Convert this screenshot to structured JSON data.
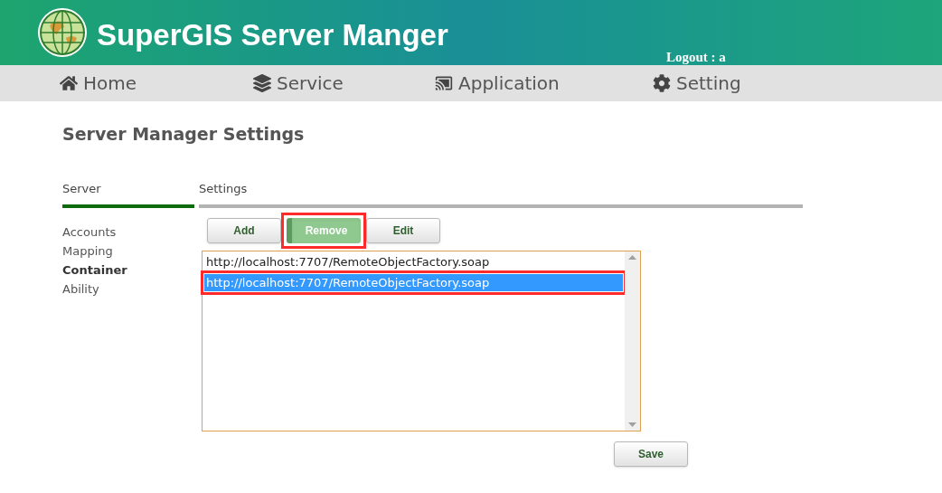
{
  "header": {
    "title": "SuperGIS Server Manger",
    "logout": "Logout : a"
  },
  "nav": [
    {
      "label": "Home"
    },
    {
      "label": "Service"
    },
    {
      "label": "Application"
    },
    {
      "label": "Setting"
    }
  ],
  "page_title": "Server Manager Settings",
  "tabs": [
    {
      "label": "Server",
      "selected": true
    },
    {
      "label": "Settings",
      "selected": false
    }
  ],
  "side_menu": [
    {
      "label": "Accounts",
      "selected": false
    },
    {
      "label": "Mapping",
      "selected": false
    },
    {
      "label": "Container",
      "selected": true
    },
    {
      "label": "Ability",
      "selected": false
    }
  ],
  "buttons": [
    {
      "label": "Add",
      "pressed": false,
      "highlighted": false
    },
    {
      "label": "Remove",
      "pressed": true,
      "highlighted": true
    },
    {
      "label": "Edit",
      "pressed": false,
      "highlighted": false
    }
  ],
  "list": [
    {
      "text": "http://localhost:7707/RemoteObjectFactory.soap",
      "selected": false,
      "highlighted": false
    },
    {
      "text": "http://localhost:7707/RemoteObjectFactory.soap",
      "selected": true,
      "highlighted": true
    }
  ],
  "save_button": "Save"
}
